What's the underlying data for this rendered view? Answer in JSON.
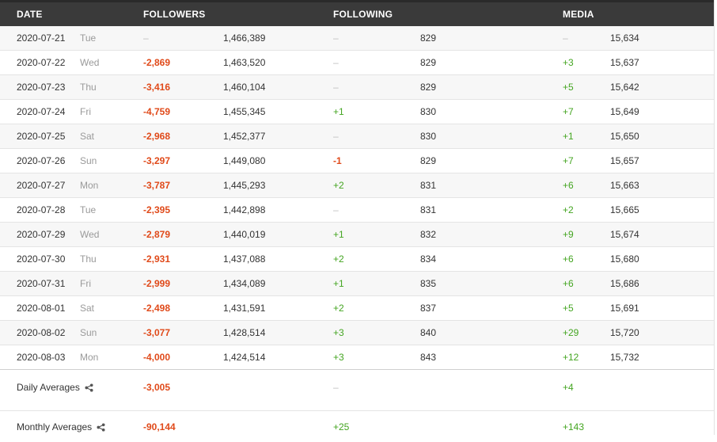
{
  "header": {
    "date": "DATE",
    "followers": "FOLLOWERS",
    "following": "FOLLOWING",
    "media": "MEDIA"
  },
  "rows": [
    {
      "date": "2020-07-21",
      "day": "Tue",
      "followers_delta": "–",
      "followers_total": "1,466,389",
      "following_delta": "–",
      "following_total": "829",
      "media_delta": "–",
      "media_total": "15,634"
    },
    {
      "date": "2020-07-22",
      "day": "Wed",
      "followers_delta": "-2,869",
      "followers_total": "1,463,520",
      "following_delta": "–",
      "following_total": "829",
      "media_delta": "+3",
      "media_total": "15,637"
    },
    {
      "date": "2020-07-23",
      "day": "Thu",
      "followers_delta": "-3,416",
      "followers_total": "1,460,104",
      "following_delta": "–",
      "following_total": "829",
      "media_delta": "+5",
      "media_total": "15,642"
    },
    {
      "date": "2020-07-24",
      "day": "Fri",
      "followers_delta": "-4,759",
      "followers_total": "1,455,345",
      "following_delta": "+1",
      "following_total": "830",
      "media_delta": "+7",
      "media_total": "15,649"
    },
    {
      "date": "2020-07-25",
      "day": "Sat",
      "followers_delta": "-2,968",
      "followers_total": "1,452,377",
      "following_delta": "–",
      "following_total": "830",
      "media_delta": "+1",
      "media_total": "15,650"
    },
    {
      "date": "2020-07-26",
      "day": "Sun",
      "followers_delta": "-3,297",
      "followers_total": "1,449,080",
      "following_delta": "-1",
      "following_total": "829",
      "media_delta": "+7",
      "media_total": "15,657"
    },
    {
      "date": "2020-07-27",
      "day": "Mon",
      "followers_delta": "-3,787",
      "followers_total": "1,445,293",
      "following_delta": "+2",
      "following_total": "831",
      "media_delta": "+6",
      "media_total": "15,663"
    },
    {
      "date": "2020-07-28",
      "day": "Tue",
      "followers_delta": "-2,395",
      "followers_total": "1,442,898",
      "following_delta": "–",
      "following_total": "831",
      "media_delta": "+2",
      "media_total": "15,665"
    },
    {
      "date": "2020-07-29",
      "day": "Wed",
      "followers_delta": "-2,879",
      "followers_total": "1,440,019",
      "following_delta": "+1",
      "following_total": "832",
      "media_delta": "+9",
      "media_total": "15,674"
    },
    {
      "date": "2020-07-30",
      "day": "Thu",
      "followers_delta": "-2,931",
      "followers_total": "1,437,088",
      "following_delta": "+2",
      "following_total": "834",
      "media_delta": "+6",
      "media_total": "15,680"
    },
    {
      "date": "2020-07-31",
      "day": "Fri",
      "followers_delta": "-2,999",
      "followers_total": "1,434,089",
      "following_delta": "+1",
      "following_total": "835",
      "media_delta": "+6",
      "media_total": "15,686"
    },
    {
      "date": "2020-08-01",
      "day": "Sat",
      "followers_delta": "-2,498",
      "followers_total": "1,431,591",
      "following_delta": "+2",
      "following_total": "837",
      "media_delta": "+5",
      "media_total": "15,691"
    },
    {
      "date": "2020-08-02",
      "day": "Sun",
      "followers_delta": "-3,077",
      "followers_total": "1,428,514",
      "following_delta": "+3",
      "following_total": "840",
      "media_delta": "+29",
      "media_total": "15,720"
    },
    {
      "date": "2020-08-03",
      "day": "Mon",
      "followers_delta": "-4,000",
      "followers_total": "1,424,514",
      "following_delta": "+3",
      "following_total": "843",
      "media_delta": "+12",
      "media_total": "15,732"
    }
  ],
  "daily_averages": {
    "label": "Daily Averages",
    "followers": "-3,005",
    "following": "–",
    "media": "+4",
    "icon": "share-icon"
  },
  "monthly_averages": {
    "label": "Monthly Averages",
    "followers": "-90,144",
    "following": "+25",
    "media": "+143",
    "icon": "share-icon"
  },
  "colors": {
    "header_bg": "#3a3a3a",
    "negative": "#e04a1a",
    "positive": "#44a521",
    "neutral": "#bdbdbd"
  }
}
